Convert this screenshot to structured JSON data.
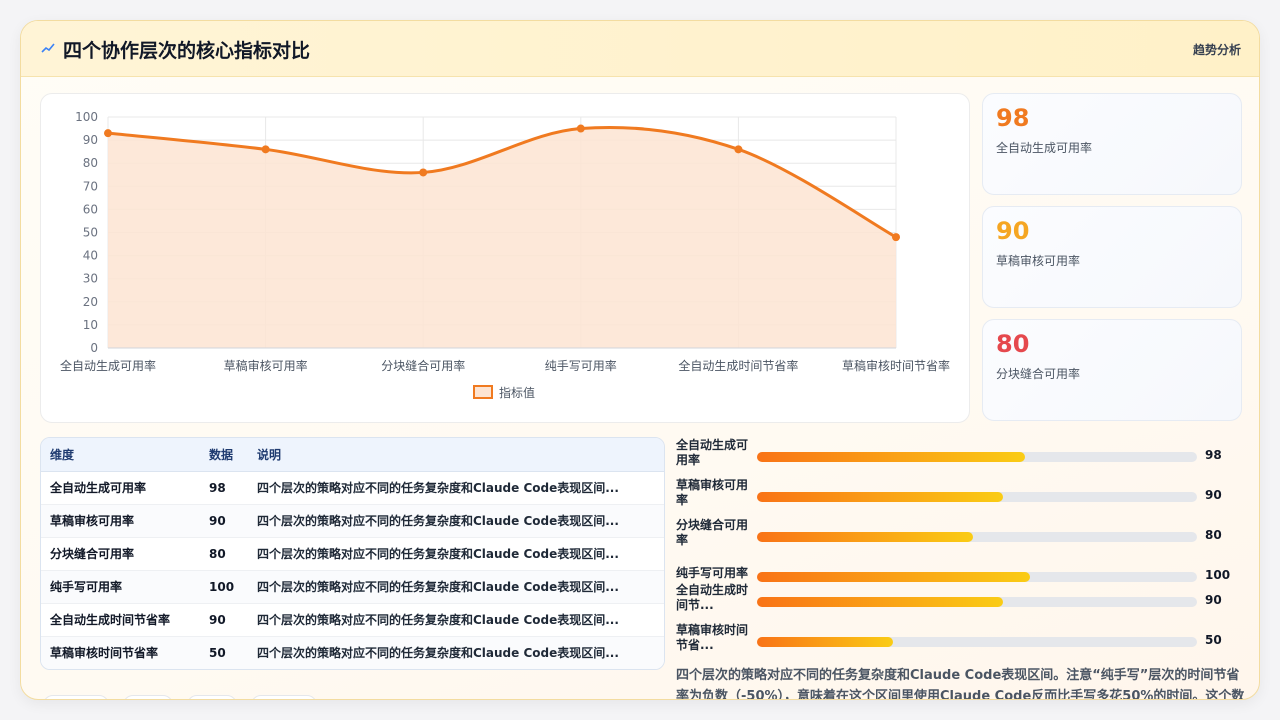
{
  "header": {
    "title": "四个协作层次的核心指标对比",
    "tag": "趋势分析",
    "icon": "trend-icon"
  },
  "chart_data": {
    "type": "area",
    "categories": [
      "全自动生成可用率",
      "草稿审核可用率",
      "分块缝合可用率",
      "纯手写可用率",
      "全自动生成时间节省率",
      "草稿审核时间节省率"
    ],
    "series": [
      {
        "name": "指标值",
        "values": [
          93,
          86,
          76,
          95,
          86,
          48
        ]
      }
    ],
    "ylim": [
      0,
      100
    ],
    "yticks": [
      0,
      10,
      20,
      30,
      40,
      50,
      60,
      70,
      80,
      90,
      100
    ],
    "grid": true,
    "legend": "bottom",
    "colors": {
      "line": "#f07a20",
      "fill": "#fde4d2"
    }
  },
  "kpis": [
    {
      "value": "98",
      "label": "全自动生成可用率",
      "color": "#f07a20"
    },
    {
      "value": "90",
      "label": "草稿审核可用率",
      "color": "#f5a623"
    },
    {
      "value": "80",
      "label": "分块缝合可用率",
      "color": "#e5484d"
    }
  ],
  "table": {
    "headers": [
      "维度",
      "数据",
      "说明"
    ],
    "rows": [
      {
        "dim": "全自动生成可用率",
        "value": "98",
        "desc": "四个层次的策略对应不同的任务复杂度和Claude Code表现区间..."
      },
      {
        "dim": "草稿审核可用率",
        "value": "90",
        "desc": "四个层次的策略对应不同的任务复杂度和Claude Code表现区间..."
      },
      {
        "dim": "分块缝合可用率",
        "value": "80",
        "desc": "四个层次的策略对应不同的任务复杂度和Claude Code表现区间..."
      },
      {
        "dim": "纯手写可用率",
        "value": "100",
        "desc": "四个层次的策略对应不同的任务复杂度和Claude Code表现区间..."
      },
      {
        "dim": "全自动生成时间节省率",
        "value": "90",
        "desc": "四个层次的策略对应不同的任务复杂度和Claude Code表现区间..."
      },
      {
        "dim": "草稿审核时间节省率",
        "value": "50",
        "desc": "四个层次的策略对应不同的任务复杂度和Claude Code表现区间..."
      }
    ]
  },
  "progress_bars": [
    {
      "label": "全自动生成可用率",
      "value": "98",
      "fill_pct": 61
    },
    {
      "label": "草稿审核可用率",
      "value": "90",
      "fill_pct": 56
    },
    {
      "label": "分块缝合可用率",
      "value": "80",
      "fill_pct": 49
    },
    {
      "label": "纯手写可用率",
      "value": "100",
      "fill_pct": 62
    },
    {
      "label": "全自动生成时间节...",
      "value": "90",
      "fill_pct": 56
    },
    {
      "label": "草稿审核时间节省...",
      "value": "50",
      "fill_pct": 31
    }
  ],
  "note": "四个层次的策略对应不同的任务复杂度和Claude Code表现区间。注意“纯手写”层次的时间节省率为负数（-50%），意味着在这个区间里使用Claude Code反而比手写多花50%的时间。这个数据真"
}
